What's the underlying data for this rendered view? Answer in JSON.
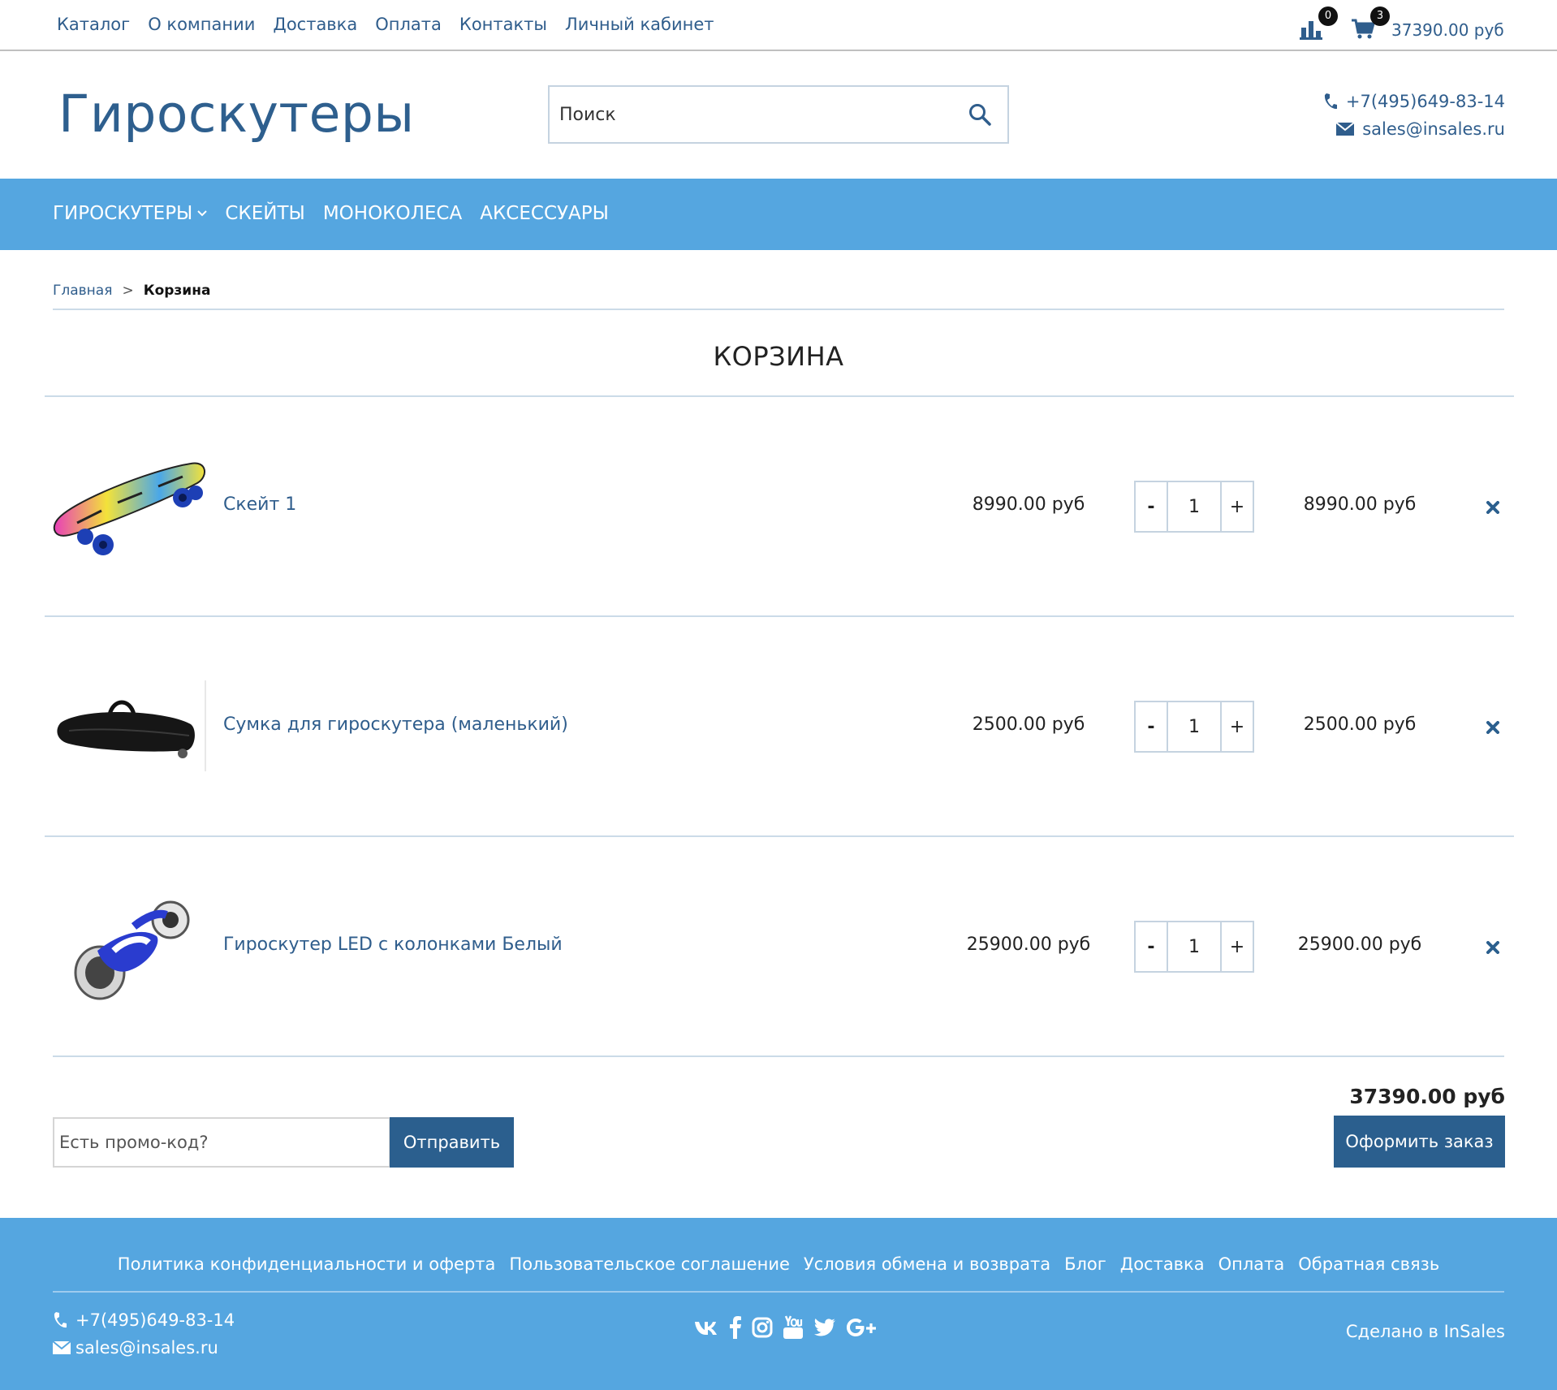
{
  "top_nav": [
    "Каталог",
    "О компании",
    "Доставка",
    "Оплата",
    "Контакты",
    "Личный кабинет"
  ],
  "compare_count": "0",
  "cart_count": "3",
  "cart_total": "37390.00 руб",
  "logo": "Гироскутеры",
  "search": {
    "placeholder": "Поиск"
  },
  "contacts": {
    "phone": "+7(495)649-83-14",
    "email": "sales@insales.ru"
  },
  "main_nav": [
    "ГИРОСКУТЕРЫ",
    "СКЕЙТЫ",
    "МОНОКОЛЕСА",
    "АКСЕССУАРЫ"
  ],
  "breadcrumb": {
    "home": "Главная",
    "separator": ">",
    "current": "Корзина"
  },
  "page_title": "КОРЗИНА",
  "cart_items": [
    {
      "name": "Скейт 1",
      "price": "8990.00 руб",
      "qty": "1",
      "sum": "8990.00 руб",
      "image": "skateboard"
    },
    {
      "name": "Сумка для гироскутера (маленький)",
      "price": "2500.00 руб",
      "qty": "1",
      "sum": "2500.00 руб",
      "image": "hoverboard-bag"
    },
    {
      "name": "Гироскутер LED с колонками Белый",
      "price": "25900.00 руб",
      "qty": "1",
      "sum": "25900.00 руб",
      "image": "hoverboard"
    }
  ],
  "qty_minus": "-",
  "qty_plus": "+",
  "order_total": "37390.00 руб",
  "promo": {
    "placeholder": "Есть промо-код?",
    "button": "Отправить"
  },
  "checkout_button": "Оформить заказ",
  "footer": {
    "links": [
      "Политика конфиденциальности и оферта",
      "Пользовательское соглашение",
      "Условия обмена и возврата",
      "Блог",
      "Доставка",
      "Оплата",
      "Обратная связь"
    ],
    "phone": "+7(495)649-83-14",
    "email": "sales@insales.ru",
    "socials": [
      "vk-icon",
      "facebook-icon",
      "instagram-icon",
      "youtube-icon",
      "twitter-icon",
      "google-plus-icon"
    ],
    "made_by": "Сделано в InSales"
  },
  "colors": {
    "accent": "#55a6e0",
    "brand_dark": "#2b5f8e",
    "link": "#2f5d8c"
  }
}
